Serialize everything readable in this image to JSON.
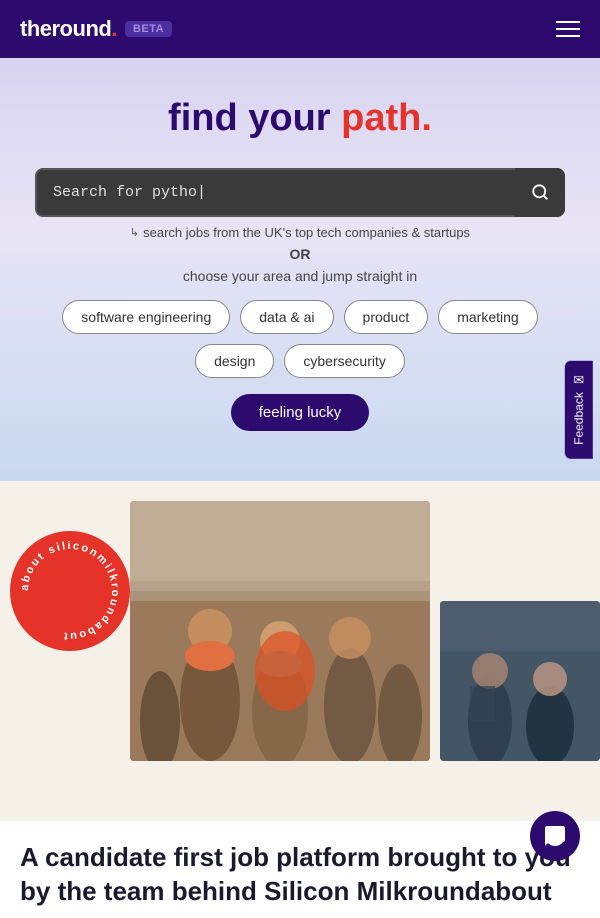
{
  "header": {
    "logo_text": "theround",
    "logo_dot": ".",
    "beta_label": "BETA",
    "menu_icon": "☰"
  },
  "hero": {
    "title_part1": "find your ",
    "title_highlight": "path",
    "title_dot": ".",
    "search_placeholder": "Search for pytho|",
    "search_hint": "search jobs from the UK's top tech companies & startups",
    "or_text": "OR",
    "choose_text": "choose your area and jump straight in",
    "categories": [
      "software engineering",
      "data & ai",
      "product",
      "marketing",
      "design",
      "cybersecurity"
    ],
    "lucky_button": "feeling lucky"
  },
  "feedback": {
    "label": "Feedback",
    "icon": "✉"
  },
  "about": {
    "circle_text": "about siliconmilkroundabout",
    "badge_text": "about siliconmilkroundabout"
  },
  "bottom_cta": {
    "title": "A candidate first job platform brought to you by the team behind Silicon Milkroundabout"
  },
  "chat": {
    "icon": "💬"
  }
}
